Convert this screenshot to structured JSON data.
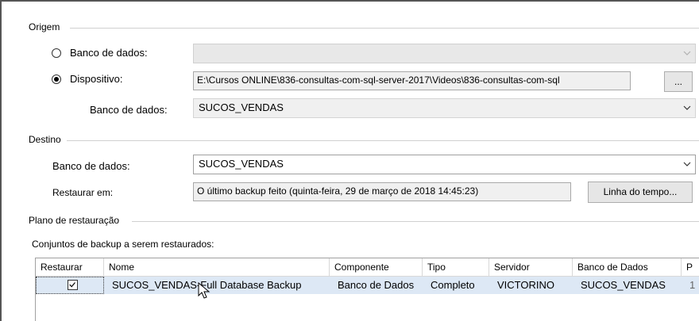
{
  "origem": {
    "title": "Origem",
    "radio_database_label": "Banco de dados:",
    "radio_device_label": "Dispositivo:",
    "device_path": "E:\\Cursos ONLINE\\836-consultas-com-sql-server-2017\\Videos\\836-consultas-com-sql",
    "browse_label": "...",
    "database_label": "Banco de dados:",
    "database_value": "SUCOS_VENDAS"
  },
  "destino": {
    "title": "Destino",
    "database_label": "Banco de dados:",
    "database_value": "SUCOS_VENDAS",
    "restore_to_label": "Restaurar em:",
    "restore_to_value": "O último backup feito (quinta-feira, 29 de março de 2018 14:45:23)",
    "timeline_button": "Linha do tempo..."
  },
  "plano": {
    "title": "Plano de restauração",
    "sets_label": "Conjuntos de backup a serem restaurados:",
    "columns": [
      "Restaurar",
      "Nome",
      "Componente",
      "Tipo",
      "Servidor",
      "Banco de Dados",
      "P"
    ],
    "rows": [
      {
        "restore": true,
        "name": "SUCOS_VENDAS-Full Database Backup",
        "component": "Banco de Dados",
        "type": "Completo",
        "server": "VICTORINO",
        "database": "SUCOS_VENDAS",
        "extra": "1"
      }
    ]
  },
  "colors": {
    "selection_row": "#dde8f5",
    "section_line": "#d0d0d0"
  }
}
